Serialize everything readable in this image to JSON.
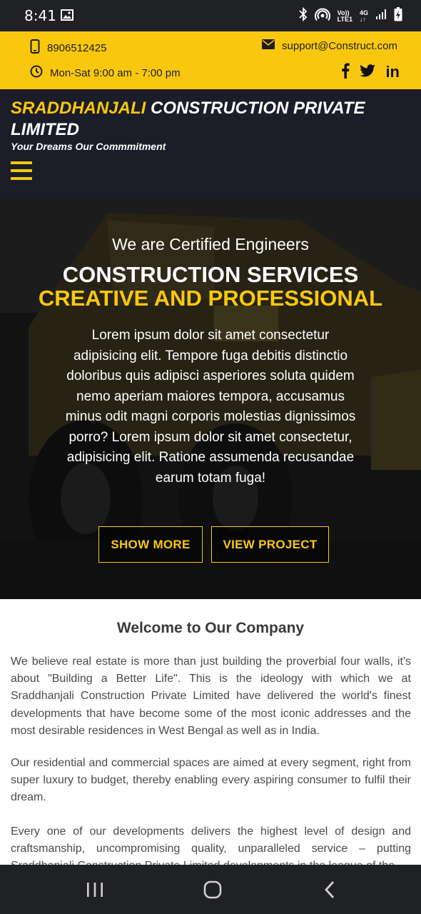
{
  "status_bar": {
    "time": "8:41",
    "icons": [
      "gallery-icon",
      "bluetooth-icon",
      "hotspot-icon",
      "volte-icon",
      "4g-icon",
      "signal-icon",
      "battery-icon"
    ],
    "volte_label_top": "Vo))",
    "volte_label_bottom": "LTE1",
    "net_label": "4G"
  },
  "topbar": {
    "phone": "8906512425",
    "email": "support@Construct.com",
    "hours": "Mon-Sat 9:00 am - 7:00 pm",
    "social": [
      "facebook-icon",
      "twitter-icon",
      "linkedin-icon"
    ],
    "linkedin_label": "in",
    "background": "#f9c80e"
  },
  "header": {
    "brand_accent": "SRADDHANJALI",
    "brand_rest": " CONSTRUCTION PRIVATE LIMITED",
    "tagline": "Your Dreams Our Commmitment",
    "menu_icon": "hamburger-icon",
    "background": "#1b1d28"
  },
  "hero": {
    "eyebrow": "We are Certified Engineers",
    "title": "CONSTRUCTION SERVICES",
    "title_accent": "CREATIVE AND PROFESSIONAL",
    "body": "Lorem ipsum dolor sit amet consectetur adipisicing elit. Tempore fuga debitis distinctio doloribus quis adipisci asperiores soluta quidem nemo aperiam maiores tempora, accusamus minus odit magni corporis molestias dignissimos porro? Lorem ipsum dolor sit amet consectetur, adipisicing elit. Ratione assumenda recusandae earum totam fuga!",
    "show_more": "SHOW MORE",
    "view_project": "VIEW PROJECT",
    "accent": "#f9c80e"
  },
  "about": {
    "title": "Welcome to Our Company",
    "paragraphs": [
      "We believe real estate is more than just building the proverbial four walls, it's about \"Building a Better Life\". This is the ideology with which we at Sraddhanjali Construction Private Limited have delivered the world's finest developments that have become some of the most iconic addresses and the most desirable residences in West Bengal as well as in India.",
      "Our residential and commercial spaces are aimed at every segment, right from super luxury to budget, thereby enabling every aspiring consumer to fulfil their dream.",
      "Every one of our developments delivers the highest level of design and craftsmanship, uncompromising quality, unparalleled service – putting Sraddhanjali Construction Private Limited developments in the league of the"
    ]
  },
  "nav_bar": {
    "icons": [
      "recents-icon",
      "home-icon",
      "back-icon"
    ]
  }
}
